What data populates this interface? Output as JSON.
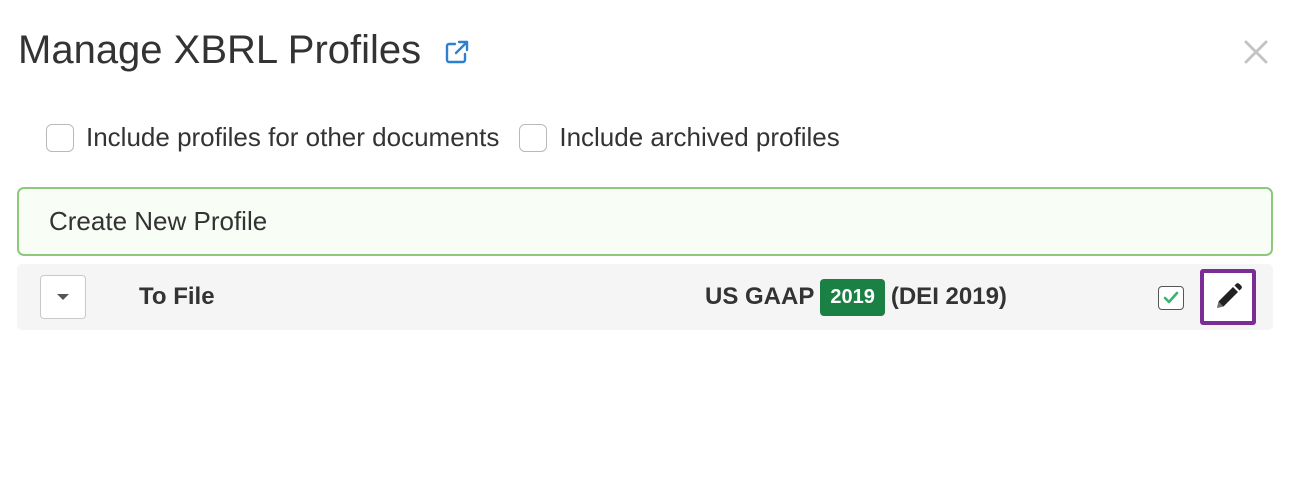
{
  "dialog": {
    "title": "Manage XBRL Profiles",
    "external_link_icon": "external-link-icon",
    "close_icon": "close-icon"
  },
  "options": {
    "include_other_documents": {
      "label": "Include profiles for other documents",
      "checked": false
    },
    "include_archived": {
      "label": "Include archived profiles",
      "checked": false
    }
  },
  "create_profile": {
    "label": "Create New Profile"
  },
  "profiles": [
    {
      "name": "To File",
      "taxonomy": "US GAAP",
      "year": "2019",
      "dei": "(DEI 2019)",
      "active": true,
      "expand_icon": "caret-down-icon",
      "edit_icon": "pencil-icon"
    }
  ],
  "colors": {
    "accent_blue": "#2f7fd0",
    "year_badge": "#1a8043",
    "create_border": "#8cc97a",
    "edit_highlight": "#7b2d96",
    "check_green": "#3cb371"
  }
}
